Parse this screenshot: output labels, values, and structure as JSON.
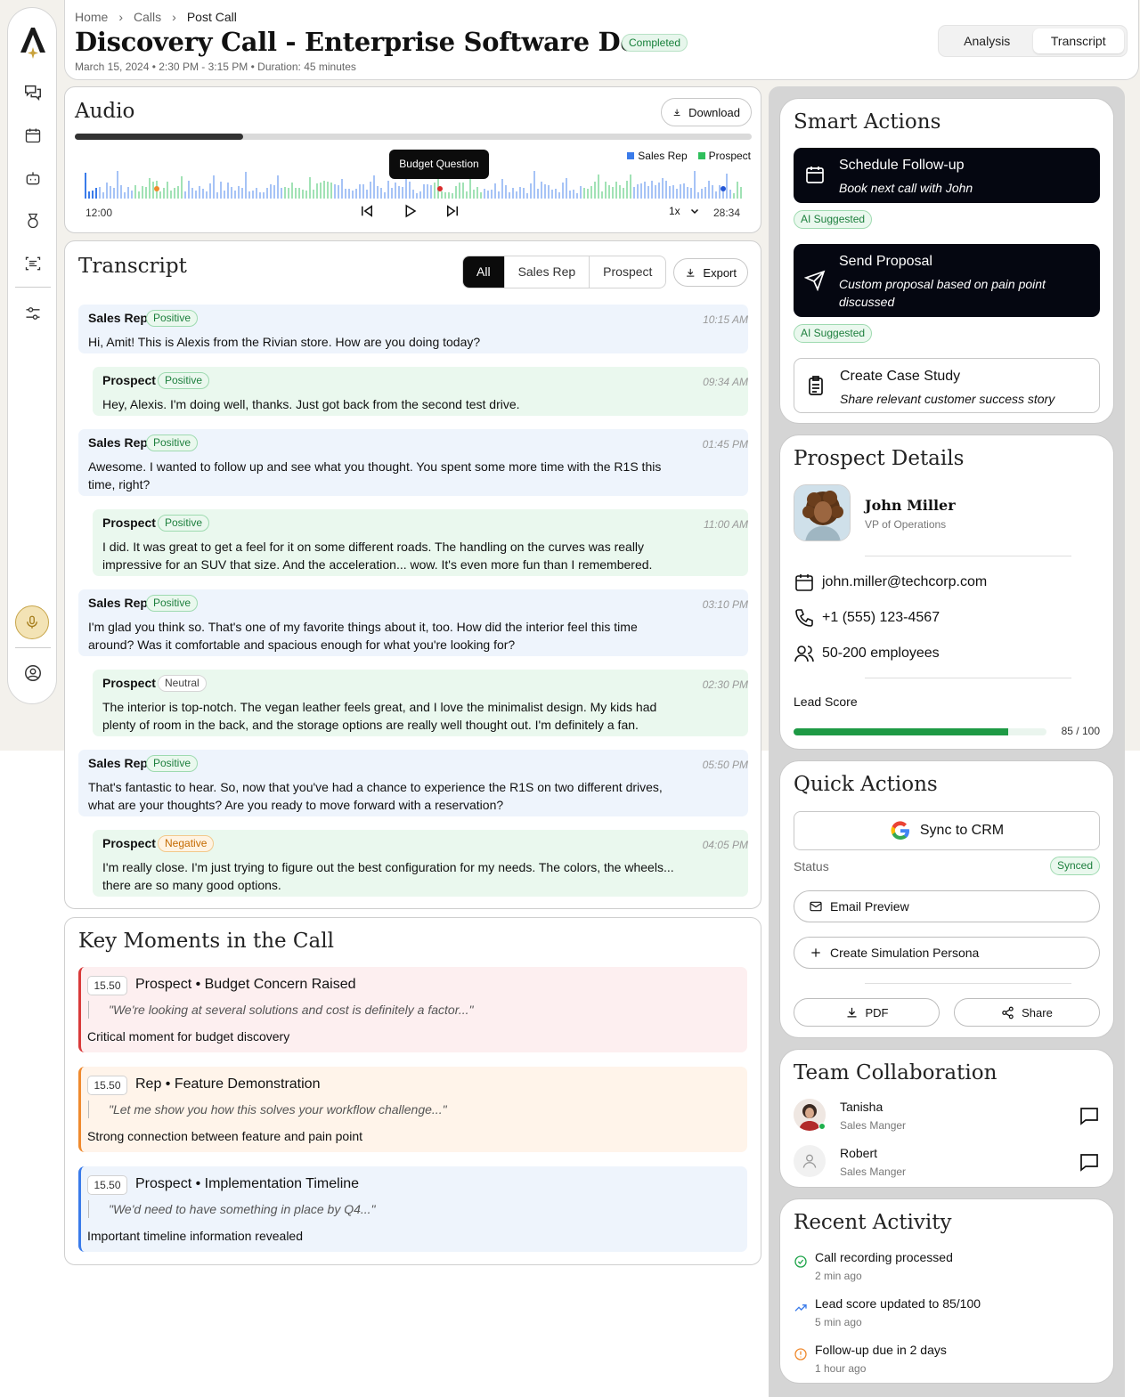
{
  "header": {
    "breadcrumb": [
      "Home",
      "Calls",
      "Post Call"
    ],
    "title": "Discovery Call - Enterprise Software Demo",
    "status": "Completed",
    "meta": "March 15, 2024 • 2:30 PM - 3:15 PM • Duration: 45 minutes",
    "tabs": [
      "Analysis",
      "Transcript"
    ],
    "active_tab": "Transcript"
  },
  "audio": {
    "title": "Audio",
    "download_label": "Download",
    "progress_fraction": 0.249,
    "legend": [
      "Sales Rep",
      "Prospect"
    ],
    "tooltip": "Budget Question",
    "time_start": "12:00",
    "time_end": "28:34",
    "speed": "1x",
    "colors": {
      "rep": "#3a7bea",
      "prospect": "#2fbf5c"
    }
  },
  "transcript": {
    "title": "Transcript",
    "filters": [
      "All",
      "Sales Rep",
      "Prospect"
    ],
    "active_filter": "All",
    "export_label": "Export",
    "messages": [
      {
        "speaker": "Sales Rep",
        "sentiment": "Positive",
        "time": "10:15 AM",
        "text": "Hi, Amit! This is Alexis from the Rivian store. How are you doing today?"
      },
      {
        "speaker": "Prospect",
        "sentiment": "Positive",
        "time": "09:34 AM",
        "text": "Hey, Alexis. I'm doing well, thanks. Just got back from the second test drive."
      },
      {
        "speaker": "Sales Rep",
        "sentiment": "Positive",
        "time": "01:45 PM",
        "text": "Awesome. I wanted to follow up and see what you thought. You spent some more time with the R1S this time, right?"
      },
      {
        "speaker": "Prospect",
        "sentiment": "Positive",
        "time": "11:00 AM",
        "text": " I did. It was great to get a feel for it on some different roads. The handling on the curves was really impressive for an SUV that size. And the acceleration... wow. It's even more fun than I remembered."
      },
      {
        "speaker": "Sales Rep",
        "sentiment": "Positive",
        "time": "03:10 PM",
        "text": "I'm glad you think so. That's one of my favorite things about it, too. How did the interior feel this time around? Was it comfortable and spacious enough for what you're looking for?"
      },
      {
        "speaker": "Prospect",
        "sentiment": "Neutral",
        "time": "02:30 PM",
        "text": "The interior is top-notch. The vegan leather feels great, and I love the minimalist design. My kids had plenty of room in the back, and the storage options are really well thought out. I'm definitely a fan."
      },
      {
        "speaker": "Sales Rep",
        "sentiment": "Positive",
        "time": "05:50 PM",
        "text": "That's fantastic to hear. So, now that you've had a chance to experience the R1S on two different drives, what are your thoughts? Are you ready to move forward with a reservation?"
      },
      {
        "speaker": "Prospect",
        "sentiment": "Negative",
        "time": "04:05 PM",
        "text": "I'm really close. I'm just trying to figure out the best configuration for my needs. The colors, the wheels... there are so many good options."
      }
    ]
  },
  "key_moments": {
    "title": "Key Moments in the Call",
    "items": [
      {
        "time": "15.50",
        "heading": "Prospect • Budget Concern Raised",
        "quote": "\"We're looking at several solutions and cost is definitely a factor...\"",
        "note": "Critical moment for budget discovery",
        "color": "#d93a3a",
        "bg": "#fdeff0"
      },
      {
        "time": "15.50",
        "heading": "Rep • Feature Demonstration",
        "quote": "\"Let me show you how this solves your workflow challenge...\"",
        "note": "Strong connection between feature and pain point",
        "color": "#ef8a2e",
        "bg": "#fff4ea"
      },
      {
        "time": "15.50",
        "heading": "Prospect • Implementation Timeline",
        "quote": "\"We'd need to have something in place by Q4...\"",
        "note": "Important timeline information revealed",
        "color": "#3a7bea",
        "bg": "#eef4fc"
      }
    ]
  },
  "smart_actions": {
    "title": "Smart Actions",
    "items": [
      {
        "title": "Schedule Follow-up",
        "subtitle": "Book next call with John",
        "badge": "AI Suggested"
      },
      {
        "title": "Send Proposal",
        "subtitle": "Custom proposal based on pain point discussed",
        "badge": "AI Suggested"
      },
      {
        "title": "Create Case Study",
        "subtitle": "Share relevant customer success story"
      }
    ]
  },
  "prospect": {
    "title": "Prospect Details",
    "name": "John Miller",
    "role": "VP of Operations",
    "email": "john.miller@techcorp.com",
    "phone": "+1 (555) 123-4567",
    "size": "50-200 employees",
    "lead_label": "Lead Score",
    "lead_score_text": "85 / 100",
    "lead_score": 85,
    "lead_max": 100
  },
  "quick_actions": {
    "title": "Quick Actions",
    "sync_label": "Sync to CRM",
    "status_label": "Status",
    "status_value": "Synced",
    "email_preview": "Email Preview",
    "persona": "Create Simulation Persona",
    "pdf": "PDF",
    "share": "Share"
  },
  "team": {
    "title": "Team Collaboration",
    "members": [
      {
        "name": "Tanisha",
        "role": "Sales Manger"
      },
      {
        "name": "Robert",
        "role": "Sales Manger"
      }
    ]
  },
  "activity": {
    "title": "Recent Activity",
    "items": [
      {
        "text": "Call recording processed",
        "time": "2 min ago"
      },
      {
        "text": "Lead score updated to 85/100",
        "time": "5 min ago"
      },
      {
        "text": "Follow-up due in 2 days",
        "time": "1 hour ago"
      }
    ]
  }
}
